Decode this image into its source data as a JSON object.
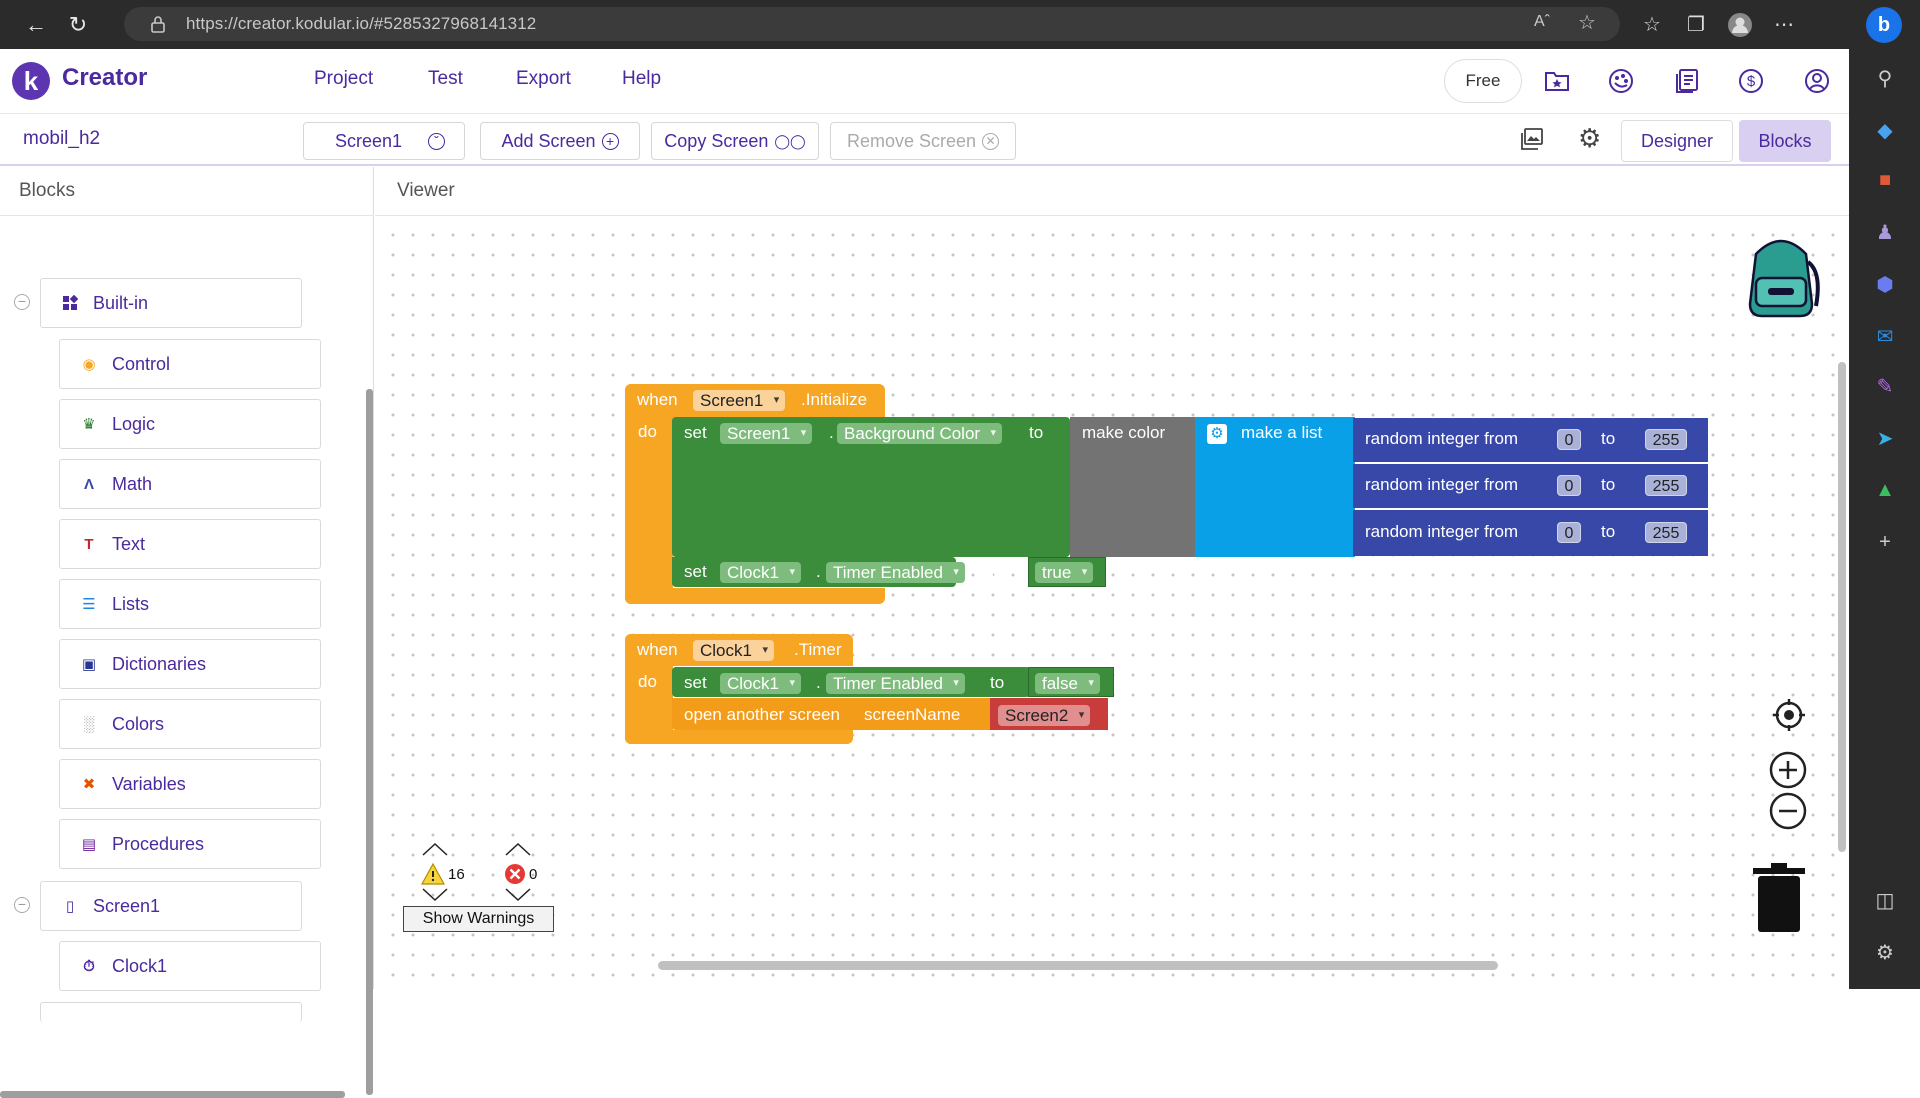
{
  "browser": {
    "url": "https://creator.kodular.io/#5285327968141312"
  },
  "app": {
    "brand": "Creator",
    "logo_letter": "k",
    "menu": [
      "Project",
      "Test",
      "Export",
      "Help"
    ],
    "plan_button": "Free"
  },
  "subbar": {
    "project_name": "mobil_h2",
    "screen_select": "Screen1",
    "add_screen": "Add Screen",
    "copy_screen": "Copy Screen",
    "remove_screen": "Remove Screen",
    "designer": "Designer",
    "blocks": "Blocks"
  },
  "left_panel": {
    "title": "Blocks",
    "built_in": "Built-in",
    "categories": [
      {
        "label": "Control",
        "icon": "control-icon",
        "color": "#f6a623"
      },
      {
        "label": "Logic",
        "icon": "logic-icon",
        "color": "#2e7d32"
      },
      {
        "label": "Math",
        "icon": "math-icon",
        "color": "#3848a8"
      },
      {
        "label": "Text",
        "icon": "text-icon",
        "color": "#c62828"
      },
      {
        "label": "Lists",
        "icon": "lists-icon",
        "color": "#1e88e5"
      },
      {
        "label": "Dictionaries",
        "icon": "dictionaries-icon",
        "color": "#283593"
      },
      {
        "label": "Colors",
        "icon": "colors-icon",
        "color": "#757575"
      },
      {
        "label": "Variables",
        "icon": "variables-icon",
        "color": "#e65100"
      },
      {
        "label": "Procedures",
        "icon": "procedures-icon",
        "color": "#6a1b9a"
      }
    ],
    "screen": "Screen1",
    "components": [
      "Clock1"
    ]
  },
  "viewer": {
    "title": "Viewer",
    "warnings_count": "16",
    "errors_count": "0",
    "show_warnings": "Show Warnings"
  },
  "blocks": {
    "event1": {
      "when": "when",
      "component": "Screen1",
      "event": ".Initialize",
      "do": "do",
      "set1": {
        "set": "set",
        "component": "Screen1",
        "dot": ".",
        "property": "Background Color",
        "to": "to",
        "make_color": "make color",
        "make_list": "make a list",
        "random_rows": [
          {
            "label": "random integer from",
            "from": "0",
            "to_label": "to",
            "to": "255"
          },
          {
            "label": "random integer from",
            "from": "0",
            "to_label": "to",
            "to": "255"
          },
          {
            "label": "random integer from",
            "from": "0",
            "to_label": "to",
            "to": "255"
          }
        ]
      },
      "set2": {
        "set": "set",
        "component": "Clock1",
        "dot": ".",
        "property": "Timer Enabled",
        "to": "to",
        "value": "true"
      }
    },
    "event2": {
      "when": "when",
      "component": "Clock1",
      "event": ".Timer",
      "do": "do",
      "set1": {
        "set": "set",
        "component": "Clock1",
        "dot": ".",
        "property": "Timer Enabled",
        "to": "to",
        "value": "false"
      },
      "open": {
        "label": "open another screen",
        "param": "screenName",
        "value": "Screen2"
      }
    }
  },
  "colors": {
    "brand": "#4a2a9e",
    "event_orange": "#f6a623",
    "setter_green": "#3b8c3b",
    "list_blue": "#0aa0e8",
    "math_navy": "#3848a8"
  }
}
